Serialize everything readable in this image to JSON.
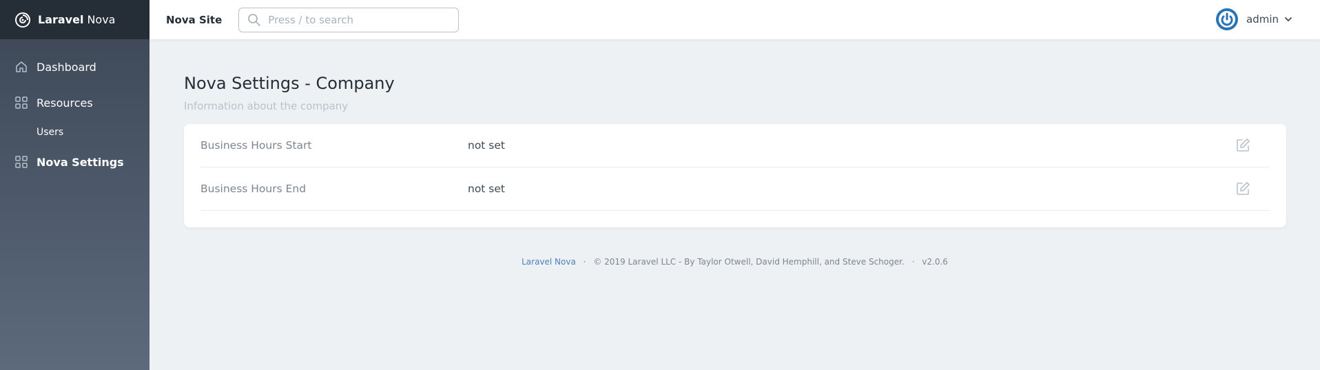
{
  "brand": {
    "bold": "Laravel",
    "light": "Nova",
    "logo_icon": "nova-logo-icon"
  },
  "sidebar": {
    "items": [
      {
        "label": "Dashboard",
        "icon": "home-icon"
      },
      {
        "label": "Resources",
        "icon": "grid-icon"
      },
      {
        "label": "Users"
      },
      {
        "label": "Nova Settings",
        "icon": "grid-icon"
      }
    ]
  },
  "header": {
    "site_name": "Nova Site",
    "search_placeholder": "Press / to search",
    "user_name": "admin"
  },
  "page": {
    "title": "Nova Settings - Company",
    "description": "Information about the company",
    "rows": [
      {
        "label": "Business Hours Start",
        "value": "not set"
      },
      {
        "label": "Business Hours End",
        "value": "not set"
      }
    ]
  },
  "footer": {
    "link": "Laravel Nova",
    "copyright": "© 2019 Laravel LLC - By Taylor Otwell, David Hemphill, and Steve Schoger.",
    "version": "v2.0.6"
  },
  "colors": {
    "sidebar_top": "#3c4655",
    "brand_bar": "#252d37",
    "background": "#eef1f4",
    "accent": "#2a74b5",
    "footer_link": "#4d7fb8"
  }
}
